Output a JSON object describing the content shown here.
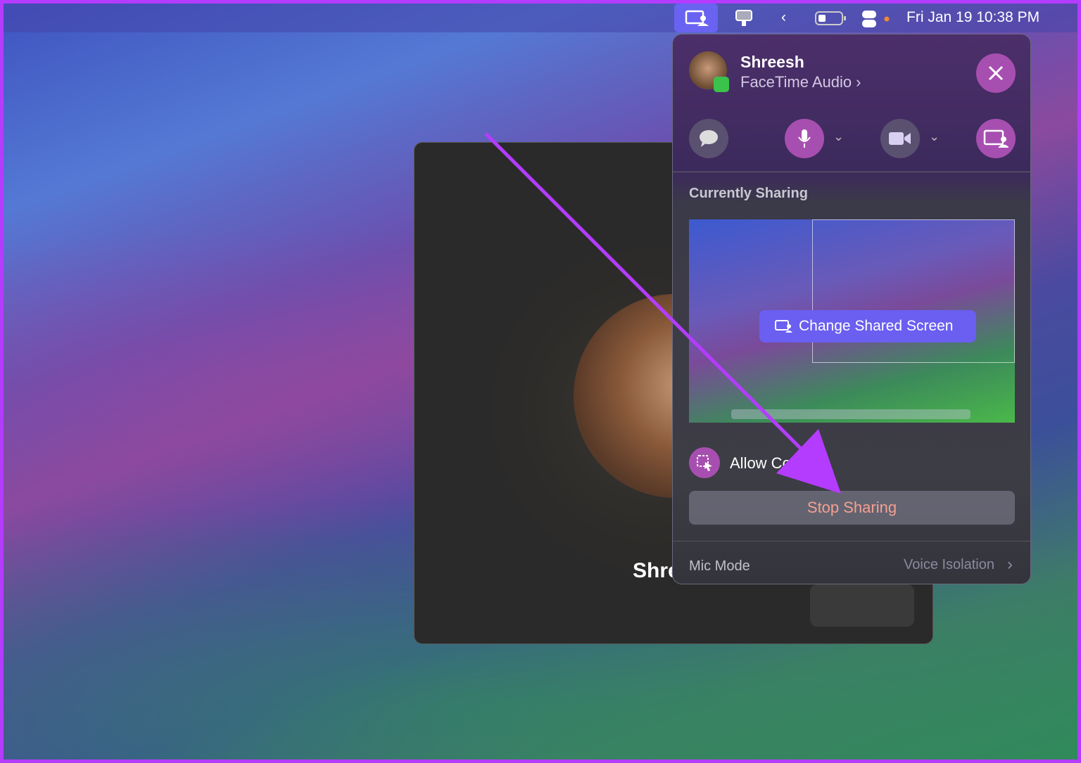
{
  "menubar": {
    "datetime": "Fri Jan 19  10:38 PM",
    "icons": [
      "screen-sharing-icon",
      "presenter-icon",
      "chevron-left-icon",
      "battery-icon",
      "control-center-icon"
    ],
    "accent": "#6a62f0"
  },
  "facetime_window": {
    "caller_name": "Shreesh"
  },
  "popover": {
    "name": "Shreesh",
    "subtitle": "FaceTime Audio",
    "controls": [
      "message-icon",
      "microphone-icon",
      "video-icon",
      "screen-share-icon"
    ],
    "section_title": "Currently Sharing",
    "change_button": "Change Shared Screen",
    "allow_label": "Allow Con",
    "stop_button": "Stop Sharing",
    "mic_mode_label": "Mic Mode",
    "mic_mode_value": "Voice Isolation",
    "accent": "#a74fb0",
    "stop_color": "#f5a090"
  },
  "annotation": {
    "arrow_color": "#b43cff"
  }
}
